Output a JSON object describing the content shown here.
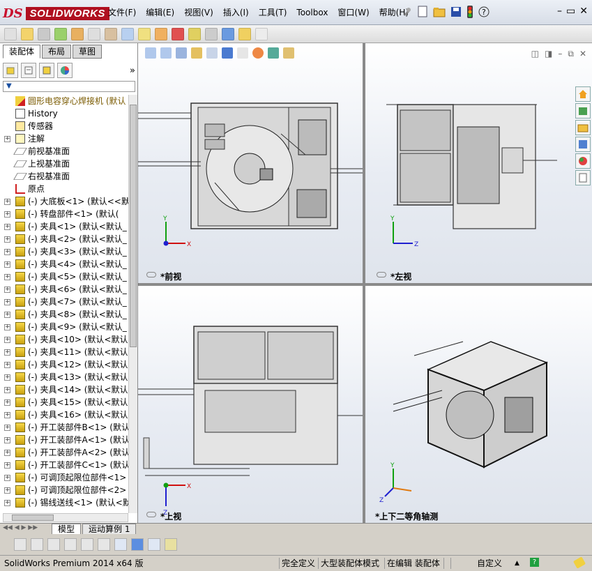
{
  "app": {
    "logo": "SOLIDWORKS",
    "colors": {
      "brand": "#b01020",
      "axis_x": "#d01010",
      "axis_y": "#10a010",
      "axis_z": "#2020d0"
    }
  },
  "menu": [
    "文件(F)",
    "编辑(E)",
    "视图(V)",
    "插入(I)",
    "工具(T)",
    "Toolbox",
    "窗口(W)",
    "帮助(H)"
  ],
  "quick_access_icons": [
    "pin-icon",
    "new-document-icon",
    "open-folder-icon",
    "save-icon",
    "traffic-light-icon",
    "help-icon"
  ],
  "window_buttons": [
    "minimize-icon",
    "restore-icon",
    "close-icon"
  ],
  "feature_manager": {
    "tabs": [
      "装配体",
      "布局",
      "草图"
    ],
    "active_tab": 0,
    "tree": [
      {
        "label": "圆形电容穿心焊接机  (默认",
        "icon": "assembly-warning-icon",
        "expand": false,
        "warn": true
      },
      {
        "label": "History",
        "icon": "history-icon",
        "expand": false
      },
      {
        "label": "传感器",
        "icon": "sensor-icon",
        "expand": false
      },
      {
        "label": "注解",
        "icon": "annotation-icon",
        "expand": true
      },
      {
        "label": "前视基准面",
        "icon": "plane-icon",
        "expand": false
      },
      {
        "label": "上视基准面",
        "icon": "plane-icon",
        "expand": false
      },
      {
        "label": "右视基准面",
        "icon": "plane-icon",
        "expand": false
      },
      {
        "label": "原点",
        "icon": "origin-icon",
        "expand": false
      },
      {
        "label": "(-) 大底板<1>  (默认<<默",
        "icon": "part-icon",
        "expand": true
      },
      {
        "label": "(-) 转盘部件<1>  (默认(",
        "icon": "part-icon",
        "expand": true
      },
      {
        "label": "(-) 夹具<1>  (默认<默认_",
        "icon": "part-icon",
        "expand": true
      },
      {
        "label": "(-) 夹具<2>  (默认<默认_",
        "icon": "part-icon",
        "expand": true
      },
      {
        "label": "(-) 夹具<3>  (默认<默认_",
        "icon": "part-icon",
        "expand": true
      },
      {
        "label": "(-) 夹具<4>  (默认<默认_",
        "icon": "part-icon",
        "expand": true
      },
      {
        "label": "(-) 夹具<5>  (默认<默认_",
        "icon": "part-icon",
        "expand": true
      },
      {
        "label": "(-) 夹具<6>  (默认<默认_",
        "icon": "part-icon",
        "expand": true
      },
      {
        "label": "(-) 夹具<7>  (默认<默认_",
        "icon": "part-icon",
        "expand": true
      },
      {
        "label": "(-) 夹具<8>  (默认<默认_",
        "icon": "part-icon",
        "expand": true
      },
      {
        "label": "(-) 夹具<9>  (默认<默认_",
        "icon": "part-icon",
        "expand": true
      },
      {
        "label": "(-) 夹具<10>  (默认<默认",
        "icon": "part-icon",
        "expand": true
      },
      {
        "label": "(-) 夹具<11>  (默认<默认",
        "icon": "part-icon",
        "expand": true
      },
      {
        "label": "(-) 夹具<12>  (默认<默认",
        "icon": "part-icon",
        "expand": true
      },
      {
        "label": "(-) 夹具<13>  (默认<默认",
        "icon": "part-icon",
        "expand": true
      },
      {
        "label": "(-) 夹具<14>  (默认<默认",
        "icon": "part-icon",
        "expand": true
      },
      {
        "label": "(-) 夹具<15>  (默认<默认",
        "icon": "part-icon",
        "expand": true
      },
      {
        "label": "(-) 夹具<16>  (默认<默认",
        "icon": "part-icon",
        "expand": true
      },
      {
        "label": "(-) 开工装部件B<1>  (默认",
        "icon": "part-icon",
        "expand": true
      },
      {
        "label": "(-) 开工装部件A<1>  (默认",
        "icon": "part-icon",
        "expand": true
      },
      {
        "label": "(-) 开工装部件A<2>  (默认",
        "icon": "part-icon",
        "expand": true
      },
      {
        "label": "(-) 开工装部件C<1>  (默认",
        "icon": "part-icon",
        "expand": true
      },
      {
        "label": "(-) 可调顶起限位部件<1>",
        "icon": "part-icon",
        "expand": true
      },
      {
        "label": "(-) 可调顶起限位部件<2>",
        "icon": "part-icon",
        "expand": true
      },
      {
        "label": "(-) 锡线送线<1>  (默认<默",
        "icon": "part-icon",
        "expand": true
      }
    ]
  },
  "viewports": [
    {
      "label": "*前视",
      "axes": [
        "Y",
        "X"
      ]
    },
    {
      "label": "*左视",
      "axes": [
        "Y",
        "Z"
      ]
    },
    {
      "label": "*上视",
      "axes": [
        "X",
        "Z"
      ]
    },
    {
      "label": "*上下二等角轴测",
      "axes": [
        "Y",
        "Z"
      ]
    }
  ],
  "bottom_tabs": [
    "模型",
    "运动算例 1"
  ],
  "status": {
    "product": "SolidWorks Premium 2014 x64 版",
    "cells": [
      "完全定义",
      "大型装配体模式",
      "在编辑 装配体",
      "自定义"
    ]
  }
}
